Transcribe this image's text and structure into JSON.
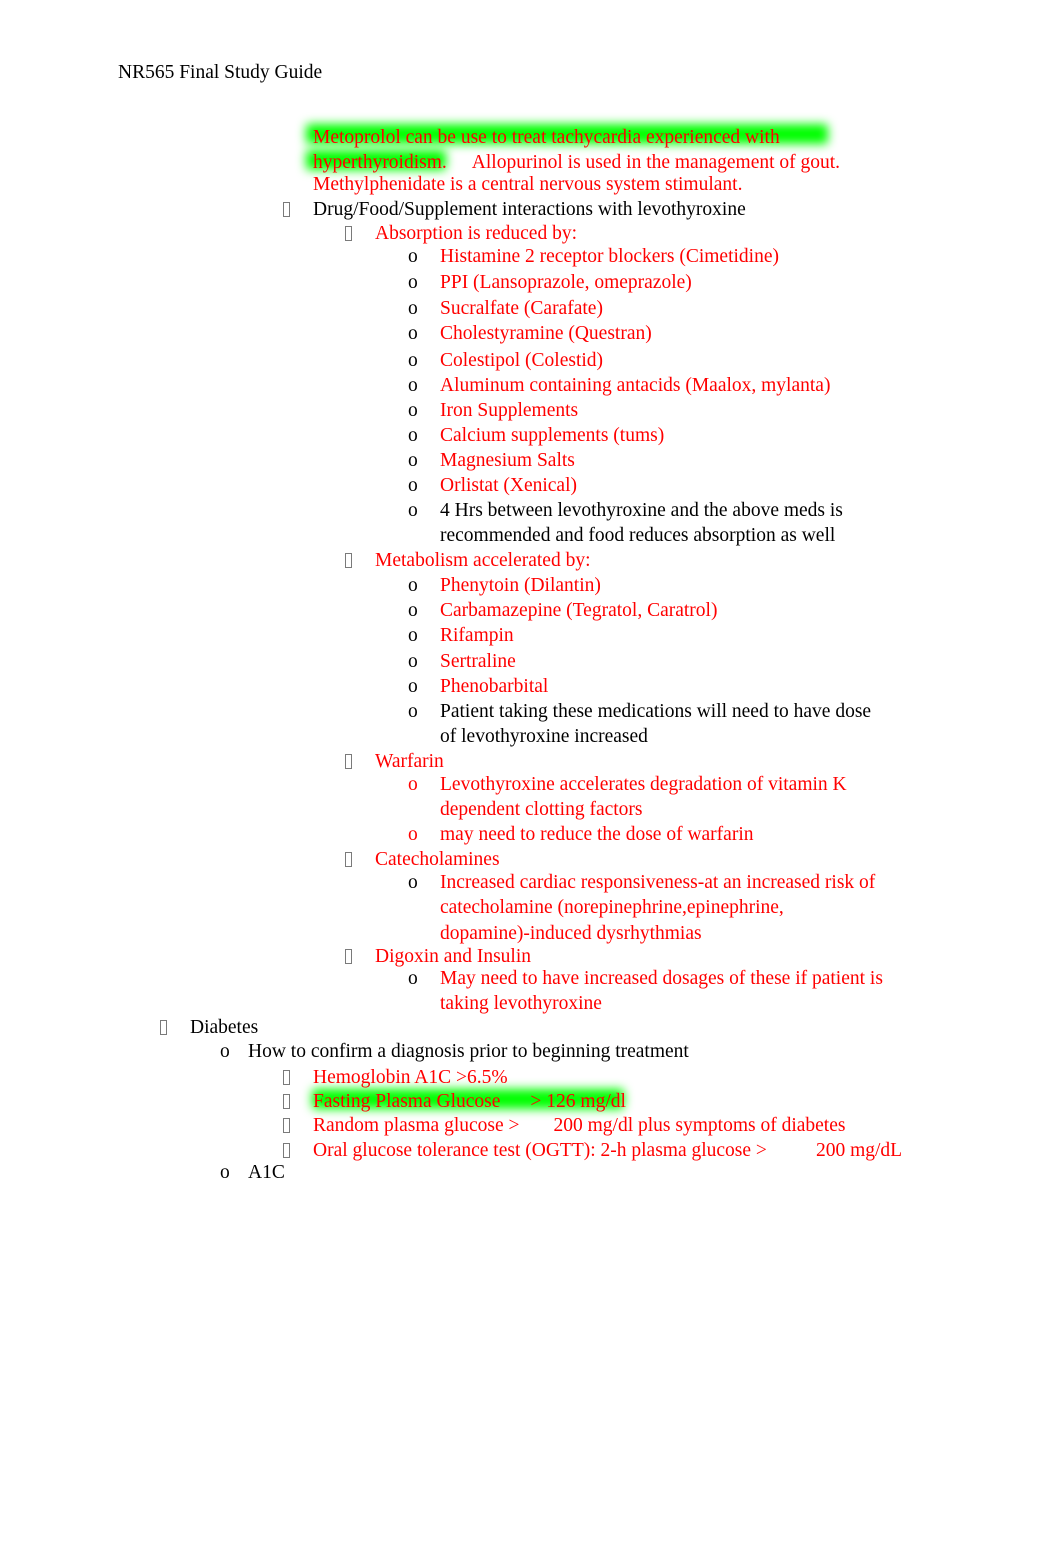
{
  "document": {
    "title": "NR565 Final Study Guide"
  },
  "colors": {
    "body_text": "#000000",
    "emphasis_text": "#FF0000",
    "highlight": "#00FF00",
    "bullet_box_outline": "#7A7A7A"
  },
  "icons": {
    "level1_bullet": "tofu-box-bullet-icon",
    "level2_bullet": "tofu-box-bullet-icon",
    "level3_bullet": "letter-o-bullet-icon"
  },
  "intro": {
    "line1": "Metoprolol can be use to treat tachycardia experienced with",
    "line2_highlighted": "hyperthyroidism.",
    "line2_rest": "Allopurinol is used in the management of gout.",
    "line3": "Methylphenidate is a central nervous system stimulant."
  },
  "sections": {
    "interactions": {
      "heading": "Drug/Food/Supplement interactions with levothyroxine",
      "groups": [
        {
          "heading": "Absorption is reduced by:",
          "items": [
            {
              "text": "Histamine 2 receptor blockers (Cimetidine)",
              "color": "red"
            },
            {
              "text": "PPI (Lansoprazole, omeprazole)",
              "color": "red"
            },
            {
              "text": "Sucralfate (Carafate)",
              "color": "red"
            },
            {
              "text": "Cholestyramine (Questran)",
              "color": "red"
            },
            {
              "text": "Colestipol (Colestid)",
              "color": "red"
            },
            {
              "text": "Aluminum containing antacids (Maalox, mylanta)",
              "color": "red"
            },
            {
              "text": "Iron Supplements",
              "color": "red"
            },
            {
              "text": "Calcium supplements (tums)",
              "color": "red"
            },
            {
              "text": "Magnesium Salts",
              "color": "red"
            },
            {
              "text": "Orlistat (Xenical)",
              "color": "red"
            },
            {
              "text": "4 Hrs between levothyroxine and the above meds is recommended and food reduces absorption as well",
              "color": "black"
            }
          ]
        },
        {
          "heading": "Metabolism accelerated by:",
          "items": [
            {
              "text": "Phenytoin (Dilantin)",
              "color": "red"
            },
            {
              "text": "Carbamazepine (Tegratol, Caratrol)",
              "color": "red"
            },
            {
              "text": "Rifampin",
              "color": "red"
            },
            {
              "text": "Sertraline",
              "color": "red"
            },
            {
              "text": "Phenobarbital",
              "color": "red"
            },
            {
              "text": "Patient taking these medications will need to have dose of levothyroxine increased",
              "color": "black"
            }
          ]
        },
        {
          "heading": "Warfarin",
          "items": [
            {
              "text": "Levothyroxine accelerates degradation of vitamin K dependent clotting factors",
              "color": "red"
            },
            {
              "text": "may need to reduce the dose of warfarin",
              "color": "red"
            }
          ]
        },
        {
          "heading": "Catecholamines",
          "items": [
            {
              "text": "Increased cardiac responsiveness-at an increased risk of catecholamine (norepinephrine,epinephrine, dopamine)-induced dysrhythmias",
              "color": "red"
            }
          ]
        },
        {
          "heading": "Digoxin and Insulin",
          "items": [
            {
              "text": "May need to have increased dosages of these if patient is taking levothyroxine",
              "color": "red"
            }
          ]
        }
      ]
    },
    "diabetes": {
      "heading": "Diabetes",
      "subheading": "How to confirm a diagnosis prior to beginning treatment",
      "criteria": [
        {
          "text": "Hemoglobin A1C >6.5%",
          "highlighted": false
        },
        {
          "text": "Fasting Plasma Glucose",
          "value": "> 126 mg/dl",
          "highlighted": true
        },
        {
          "text": "Random plasma glucose >",
          "value": "200 mg/dl plus symptoms of diabetes",
          "highlighted": false
        },
        {
          "text": "Oral glucose tolerance test (OGTT): 2-h plasma glucose >",
          "value": "200 mg/dL",
          "highlighted": false
        }
      ],
      "last_item": "A1C"
    }
  }
}
